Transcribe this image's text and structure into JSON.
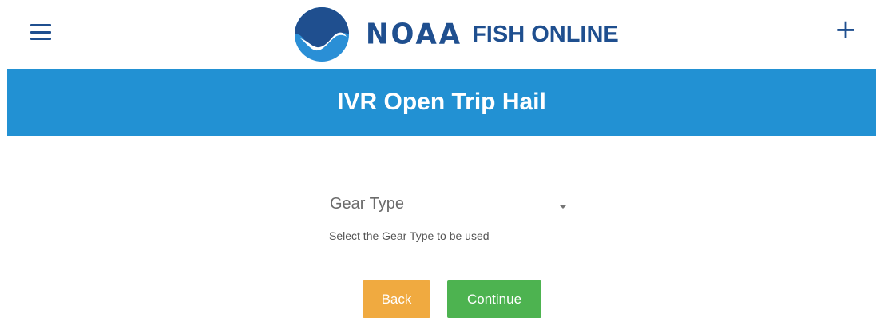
{
  "header": {
    "logo_word": "NOAA",
    "brand_name": "FISH ONLINE",
    "menu_icon": "hamburger-icon",
    "add_icon": "plus-icon",
    "add_label": "+"
  },
  "banner": {
    "title": "IVR Open Trip Hail"
  },
  "form": {
    "gear_type": {
      "label": "Gear Type",
      "helper": "Select the Gear Type to be used",
      "icon": "caret-down-icon"
    }
  },
  "actions": {
    "back_label": "Back",
    "continue_label": "Continue"
  },
  "colors": {
    "brand_blue": "#1f4f8f",
    "banner_blue": "#2291d3",
    "back_orange": "#f0aa40",
    "continue_green": "#4db350"
  }
}
